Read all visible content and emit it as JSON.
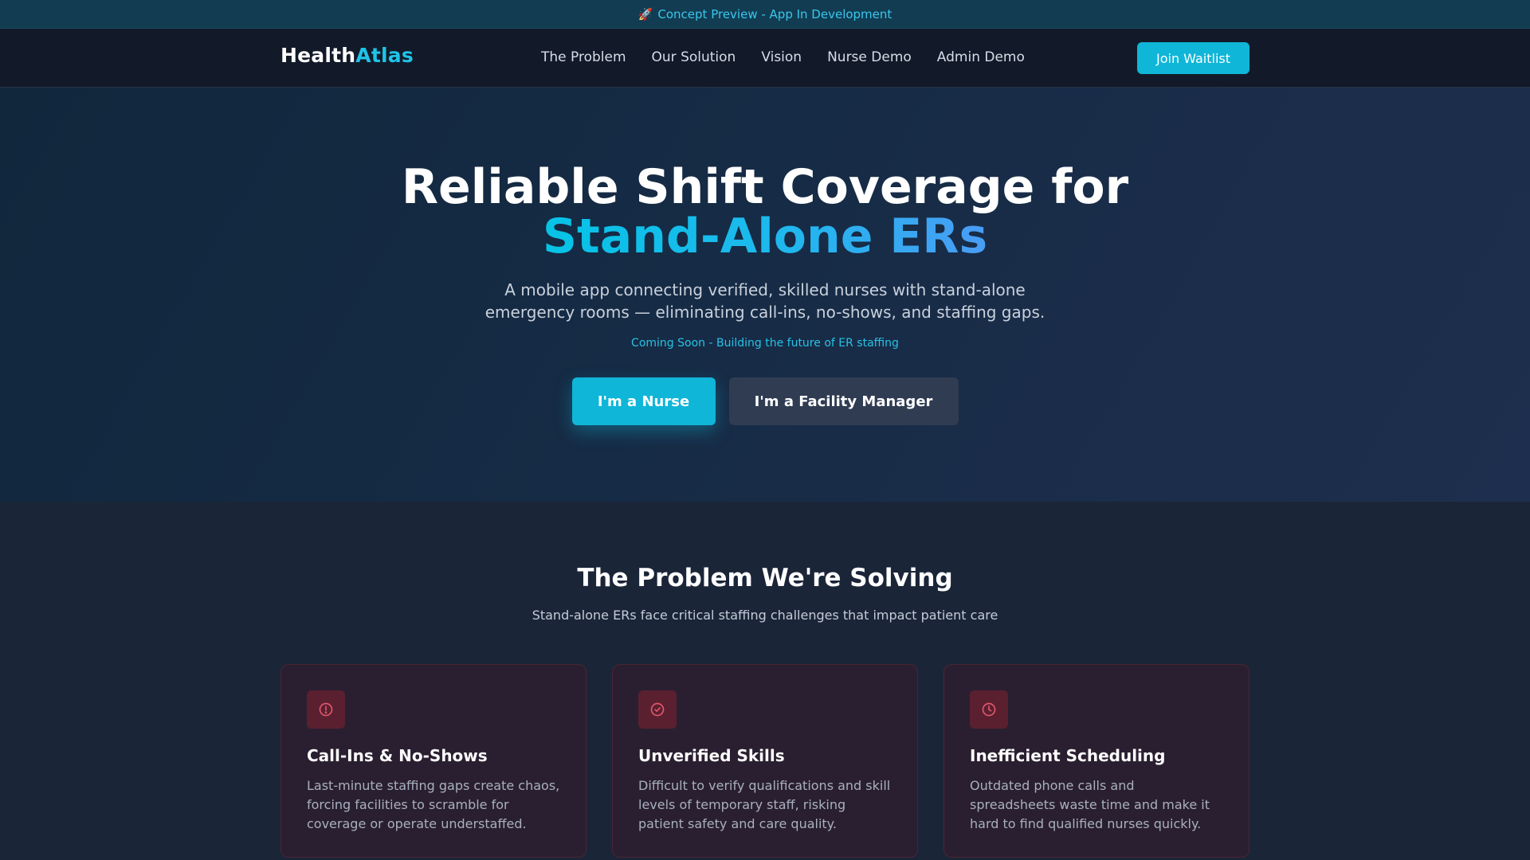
{
  "banner": {
    "icon": "rocket-icon",
    "emoji": "🚀",
    "text": "Concept Preview - App In Development"
  },
  "nav": {
    "logo_main": "Health",
    "logo_accent": "Atlas",
    "links": [
      "The Problem",
      "Our Solution",
      "Vision",
      "Nurse Demo",
      "Admin Demo"
    ],
    "cta": "Join Waitlist"
  },
  "hero": {
    "title_line1": "Reliable Shift Coverage for",
    "title_line2": "Stand-Alone ERs",
    "subtitle_line1": "A mobile app connecting verified, skilled nurses with stand-alone",
    "subtitle_line2": "emergency rooms — eliminating call-ins, no-shows, and staffing gaps.",
    "coming_soon": "Coming Soon - Building the future of ER staffing",
    "btn_nurse": "I'm a Nurse",
    "btn_facility": "I'm a Facility Manager"
  },
  "problem": {
    "title": "The Problem We're Solving",
    "subtitle": "Stand-alone ERs face critical staffing challenges that impact patient care",
    "cards": [
      {
        "icon": "alert-circle-icon",
        "title": "Call-Ins & No-Shows",
        "line1": "Last-minute staffing gaps create chaos,",
        "line2": "forcing facilities to scramble for",
        "line3": "coverage or operate understaffed."
      },
      {
        "icon": "check-circle-icon",
        "title": "Unverified Skills",
        "line1": "Difficult to verify qualifications and skill",
        "line2": "levels of temporary staff, risking",
        "line3": "patient safety and care quality."
      },
      {
        "icon": "clock-icon",
        "title": "Inefficient Scheduling",
        "line1": "Outdated phone calls and",
        "line2": "spreadsheets waste time and make it",
        "line3": "hard to find qualified nurses quickly."
      }
    ]
  },
  "colors": {
    "accent": "#0fb6d8",
    "card_icon": "#e0566b",
    "card_bg": "#2a1f30",
    "page_bg": "#1b2538"
  }
}
